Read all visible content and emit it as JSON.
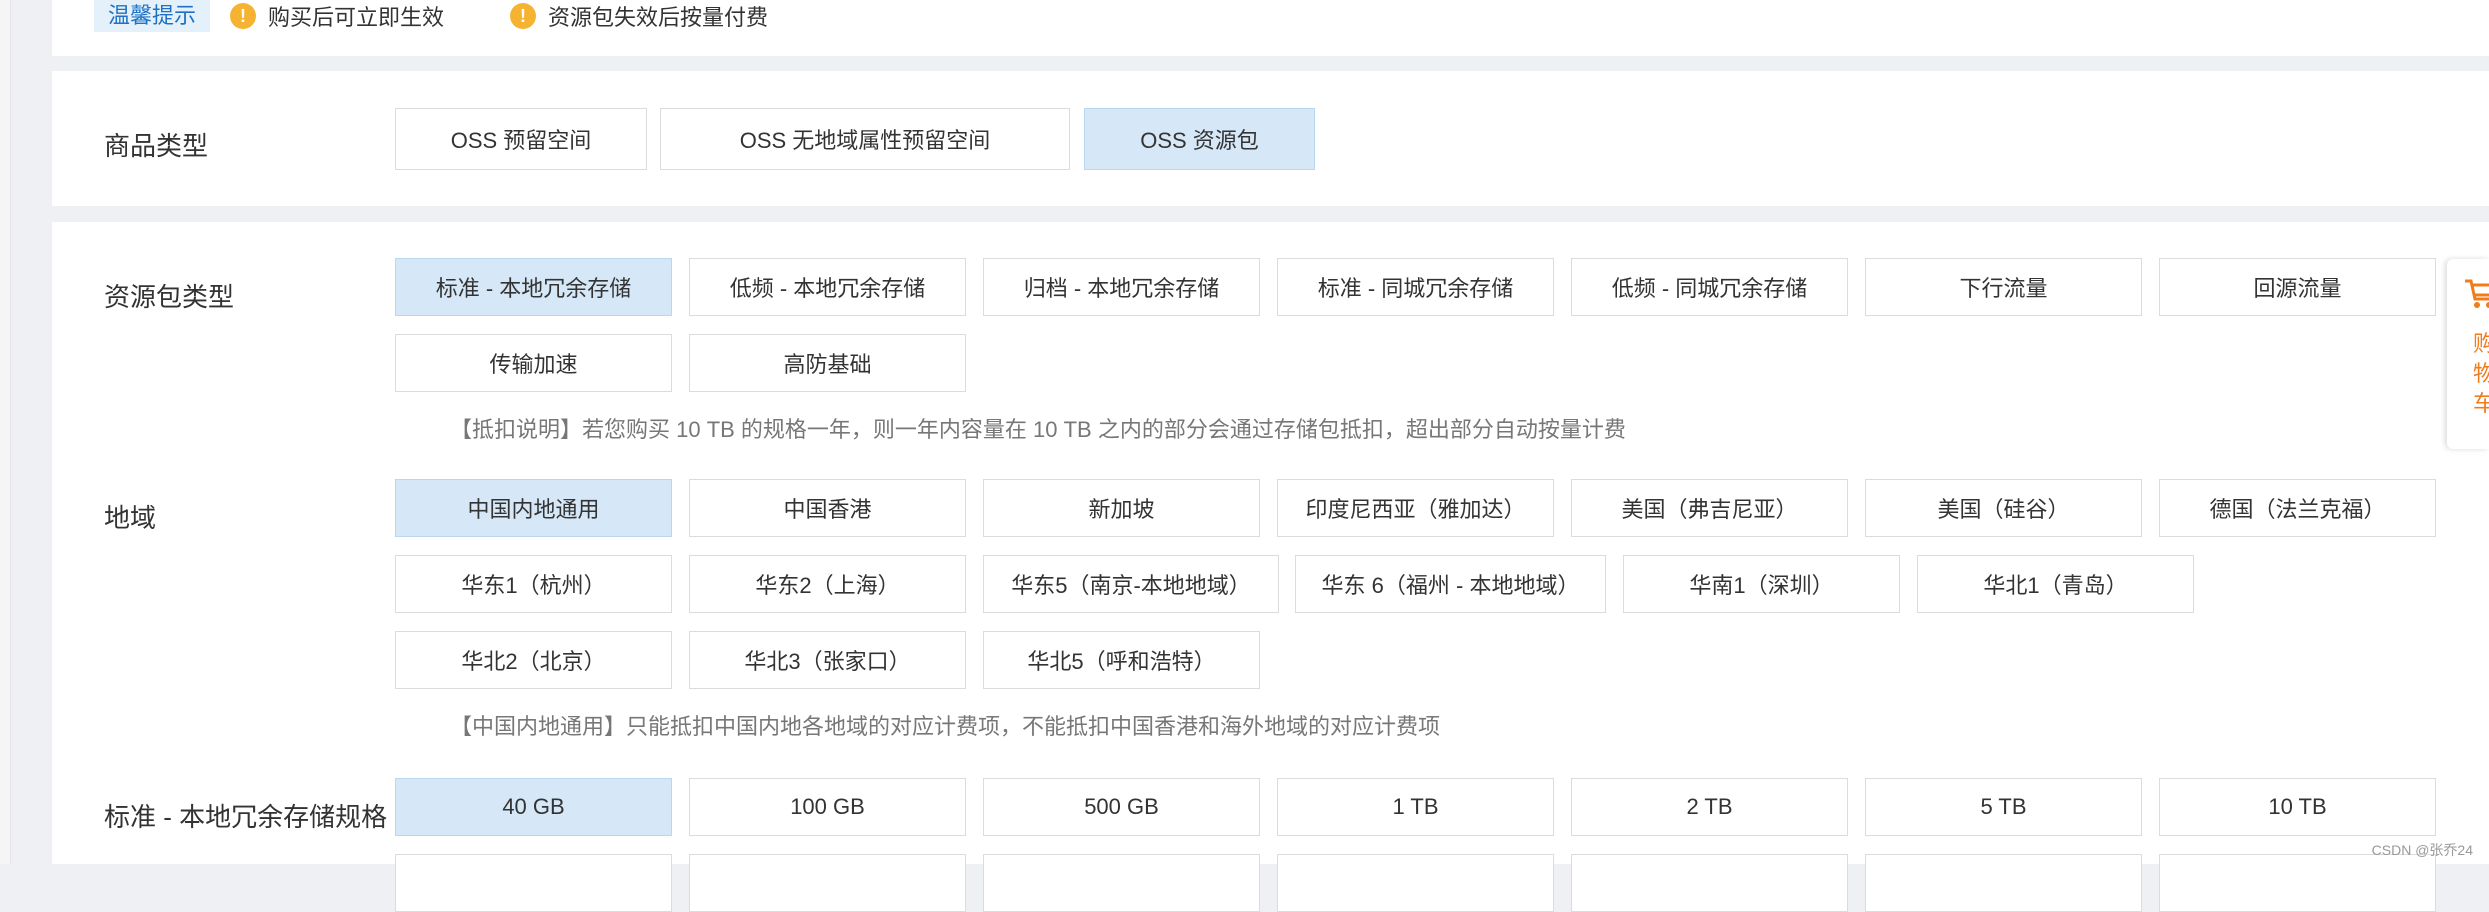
{
  "notice": {
    "tag": "温馨提示",
    "items": [
      "购买后可立即生效",
      "资源包失效后按量付费"
    ]
  },
  "product_type": {
    "label": "商品类型",
    "options": [
      "OSS 预留空间",
      "OSS 无地域属性预留空间",
      "OSS 资源包"
    ],
    "selected": "OSS 资源包"
  },
  "package_type": {
    "label": "资源包类型",
    "options": [
      "标准 - 本地冗余存储",
      "低频 - 本地冗余存储",
      "归档 - 本地冗余存储",
      "标准 - 同城冗余存储",
      "低频 - 同城冗余存储",
      "下行流量",
      "回源流量",
      "传输加速",
      "高防基础"
    ],
    "selected": "标准 - 本地冗余存储",
    "tip": "【抵扣说明】若您购买 10 TB 的规格一年，则一年内容量在 10 TB 之内的部分会通过存储包抵扣，超出部分自动按量计费"
  },
  "region": {
    "label": "地域",
    "options": [
      "中国内地通用",
      "中国香港",
      "新加坡",
      "印度尼西亚（雅加达）",
      "美国（弗吉尼亚）",
      "美国（硅谷）",
      "德国（法兰克福）",
      "华东1（杭州）",
      "华东2（上海）",
      "华东5（南京-本地地域）",
      "华东 6（福州 - 本地地域）",
      "华南1（深圳）",
      "华北1（青岛）",
      "华北2（北京）",
      "华北3（张家口）",
      "华北5（呼和浩特）"
    ],
    "selected": "中国内地通用",
    "tip": "【中国内地通用】只能抵扣中国内地各地域的对应计费项，不能抵扣中国香港和海外地域的对应计费项"
  },
  "spec": {
    "label": "标准 - 本地冗余存储规格",
    "options": [
      "40 GB",
      "100 GB",
      "500 GB",
      "1 TB",
      "2 TB",
      "5 TB",
      "10 TB"
    ],
    "selected": "40 GB"
  },
  "cart": {
    "text": "购物车",
    "icon": "cart-icon"
  },
  "watermark": "CSDN @张乔24",
  "colors": {
    "selected_bg": "#d6e8f7",
    "accent": "#1f72c3",
    "warning": "#f5b331",
    "cart": "#f07c1b"
  }
}
